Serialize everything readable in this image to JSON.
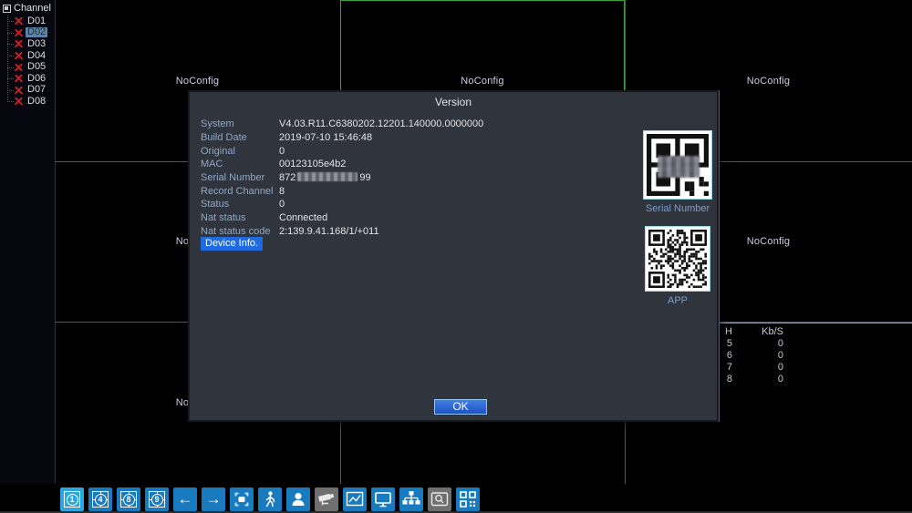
{
  "sidebar": {
    "header": "Channel",
    "items": [
      {
        "label": "D01",
        "selected": false
      },
      {
        "label": "D02",
        "selected": true
      },
      {
        "label": "D03",
        "selected": false
      },
      {
        "label": "D04",
        "selected": false
      },
      {
        "label": "D05",
        "selected": false
      },
      {
        "label": "D06",
        "selected": false
      },
      {
        "label": "D07",
        "selected": false
      },
      {
        "label": "D08",
        "selected": false
      }
    ]
  },
  "grid": {
    "no_config_label": "NoConfig"
  },
  "bitrate": {
    "ch_header": "H",
    "kbs_header": "Kb/S",
    "rows": [
      {
        "ch": "5",
        "kbs": "0"
      },
      {
        "ch": "6",
        "kbs": "0"
      },
      {
        "ch": "7",
        "kbs": "0"
      },
      {
        "ch": "8",
        "kbs": "0"
      }
    ]
  },
  "dialog": {
    "title": "Version",
    "fields": [
      {
        "label": "System",
        "value": "V4.03.R11.C6380202.12201.140000.0000000",
        "masked": false,
        "value_suffix": ""
      },
      {
        "label": "Build Date",
        "value": "2019-07-10 15:46:48",
        "masked": false,
        "value_suffix": ""
      },
      {
        "label": "Original",
        "value": "0",
        "masked": false,
        "value_suffix": ""
      },
      {
        "label": "MAC",
        "value": "00123105e4b2",
        "masked": false,
        "value_suffix": ""
      },
      {
        "label": "Serial Number",
        "value": "872",
        "masked": true,
        "value_suffix": "99"
      },
      {
        "label": "Record Channel",
        "value": "8",
        "masked": false,
        "value_suffix": ""
      },
      {
        "label": "Status",
        "value": "0",
        "masked": false,
        "value_suffix": ""
      },
      {
        "label": "Nat status",
        "value": "Connected",
        "masked": false,
        "value_suffix": ""
      },
      {
        "label": "Nat status code",
        "value": "2:139.9.41.168/1/+011",
        "masked": false,
        "value_suffix": ""
      }
    ],
    "device_info_label": "Device Info.",
    "qr_serial_label": "Serial Number",
    "qr_app_label": "APP",
    "ok_label": "OK"
  },
  "toolbar": {
    "view1": "1",
    "view4": "4",
    "view8": "8",
    "view9": "9",
    "arrow_left": "←",
    "arrow_right": "→"
  },
  "colors": {
    "toolbar_blue": "#187bc0",
    "toolbar_active_blue": "#2ba6de",
    "toolbar_gray": "#6f6f6f",
    "selection_green": "#3a9e3a",
    "dialog_bg": "#30343d",
    "label_blue": "#8fa8c6",
    "device_info_bg": "#1e6ae0",
    "offline_x_red": "#c42020"
  }
}
